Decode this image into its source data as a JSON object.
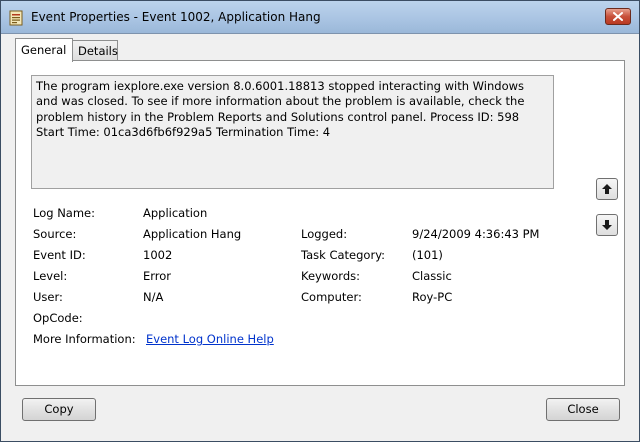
{
  "window": {
    "title": "Event Properties - Event 1002, Application Hang",
    "close_icon": "close-icon"
  },
  "tabs": [
    {
      "label": "General",
      "active": true
    },
    {
      "label": "Details",
      "active": false
    }
  ],
  "description": "The program iexplore.exe version 8.0.6001.18813 stopped interacting with Windows and was closed. To see if more information about the problem is available, check the problem history in the Problem Reports and Solutions control panel. Process ID: 598 Start Time: 01ca3d6fb6f929a5 Termination Time: 4",
  "fields": {
    "log_name": {
      "label": "Log Name:",
      "value": "Application"
    },
    "source": {
      "label": "Source:",
      "value": "Application Hang"
    },
    "logged": {
      "label": "Logged:",
      "value": "9/24/2009 4:36:43 PM"
    },
    "event_id": {
      "label": "Event ID:",
      "value": "1002"
    },
    "task_category": {
      "label": "Task Category:",
      "value": "(101)"
    },
    "level": {
      "label": "Level:",
      "value": "Error"
    },
    "keywords": {
      "label": "Keywords:",
      "value": "Classic"
    },
    "user": {
      "label": "User:",
      "value": "N/A"
    },
    "computer": {
      "label": "Computer:",
      "value": "Roy-PC"
    },
    "opcode": {
      "label": "OpCode:",
      "value": ""
    },
    "more_info": {
      "label": "More Information:",
      "link": "Event Log Online Help"
    }
  },
  "nav": {
    "up_icon": "arrow-up-icon",
    "down_icon": "arrow-down-icon"
  },
  "buttons": {
    "copy": "Copy",
    "close": "Close"
  }
}
